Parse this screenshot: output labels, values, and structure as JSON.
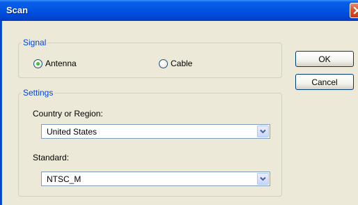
{
  "window": {
    "title": "Scan"
  },
  "signal": {
    "legend": "Signal",
    "options": [
      {
        "label": "Antenna",
        "checked": true
      },
      {
        "label": "Cable",
        "checked": false
      }
    ]
  },
  "settings": {
    "legend": "Settings",
    "country": {
      "label": "Country or Region:",
      "value": "United States"
    },
    "standard": {
      "label": "Standard:",
      "value": "NTSC_M"
    }
  },
  "buttons": {
    "ok": "OK",
    "cancel": "Cancel"
  }
}
